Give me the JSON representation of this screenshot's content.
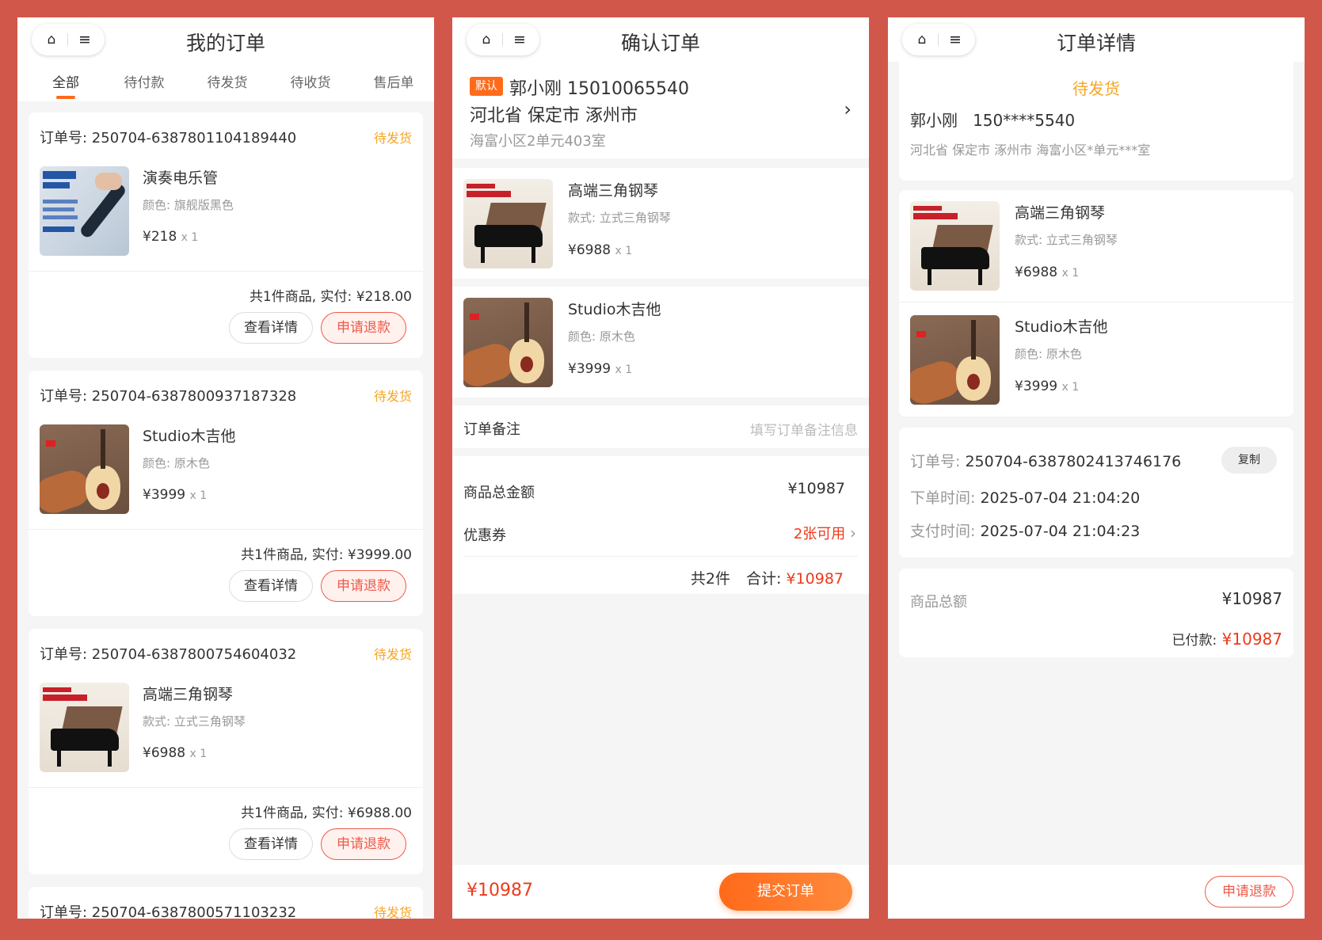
{
  "colors": {
    "accent": "#ff6b1a",
    "price_red": "#ee3a1c",
    "status_orange": "#f6a623",
    "bg": "#d2574b"
  },
  "icons": {
    "home": "home-icon",
    "menu": "menu-icon",
    "chevron": "chevron-right-icon"
  },
  "orders_page": {
    "title": "我的订单",
    "tabs": [
      {
        "label": "全部",
        "active": true
      },
      {
        "label": "待付款"
      },
      {
        "label": "待发货"
      },
      {
        "label": "待收货"
      },
      {
        "label": "售后单"
      }
    ],
    "orders": [
      {
        "order_no": "订单号: 250704-6387801104189440",
        "status": "待发货",
        "product_name": "演奏电乐管",
        "spec": "颜色: 旗舰版黑色",
        "price": "¥218",
        "qty": "x 1",
        "summary": "共1件商品, 实付: ¥218.00",
        "detail_label": "查看详情",
        "refund_label": "申请退款"
      },
      {
        "order_no": "订单号: 250704-6387800937187328",
        "status": "待发货",
        "product_name": "Studio木吉他",
        "spec": "颜色: 原木色",
        "price": "¥3999",
        "qty": "x 1",
        "summary": "共1件商品, 实付: ¥3999.00",
        "detail_label": "查看详情",
        "refund_label": "申请退款"
      },
      {
        "order_no": "订单号: 250704-6387800754604032",
        "status": "待发货",
        "product_name": "高端三角钢琴",
        "spec": "款式: 立式三角钢琴",
        "price": "¥6988",
        "qty": "x 1",
        "summary": "共1件商品, 实付: ¥6988.00",
        "detail_label": "查看详情",
        "refund_label": "申请退款"
      },
      {
        "order_no": "订单号: 250704-6387800571103232",
        "status": "待发货"
      }
    ]
  },
  "confirm_page": {
    "title": "确认订单",
    "address": {
      "default_tag": "默认",
      "name_phone": "郭小刚 15010065540",
      "region": "河北省 保定市 涿州市",
      "detail": "海富小区2单元403室"
    },
    "items": [
      {
        "name": "高端三角钢琴",
        "spec": "款式: 立式三角钢琴",
        "price": "¥6988",
        "qty": "x 1"
      },
      {
        "name": "Studio木吉他",
        "spec": "颜色: 原木色",
        "price": "¥3999",
        "qty": "x 1"
      }
    ],
    "remark_label": "订单备注",
    "remark_placeholder": "填写订单备注信息",
    "total_label": "商品总金额",
    "total_value": "¥10987",
    "coupon_label": "优惠券",
    "coupon_value": "2张可用",
    "count_text": "共2件",
    "sum_label": "合计:",
    "sum_value": "¥10987",
    "footer_price": "¥10987",
    "submit_label": "提交订单"
  },
  "detail_page": {
    "title": "订单详情",
    "status": "待发货",
    "name_phone": "郭小刚   150****5540",
    "address": "河北省 保定市 涿州市 海富小区*单元***室",
    "items": [
      {
        "name": "高端三角钢琴",
        "spec": "款式: 立式三角钢琴",
        "price": "¥6988",
        "qty": "x 1"
      },
      {
        "name": "Studio木吉他",
        "spec": "颜色: 原木色",
        "price": "¥3999",
        "qty": "x 1"
      }
    ],
    "order_no_label": "订单号:",
    "order_no": "250704-6387802413746176",
    "copy_label": "复制",
    "order_time_label": "下单时间:",
    "order_time": "2025-07-04 21:04:20",
    "pay_time_label": "支付时间:",
    "pay_time": "2025-07-04 21:04:23",
    "goods_total_label": "商品总额",
    "goods_total": "¥10987",
    "paid_label": "已付款:",
    "paid_value": "¥10987",
    "refund_label": "申请退款"
  }
}
